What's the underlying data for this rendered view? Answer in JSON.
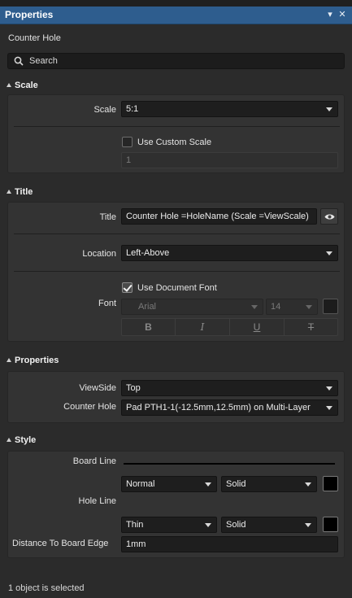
{
  "window": {
    "title": "Properties"
  },
  "object_type": "Counter Hole",
  "search": {
    "placeholder": "Search"
  },
  "sections": {
    "scale": {
      "header": "Scale",
      "scale_label": "Scale",
      "scale_value": "5:1",
      "use_custom_scale_label": "Use Custom Scale",
      "use_custom_scale_checked": false,
      "custom_scale_value": "1"
    },
    "title": {
      "header": "Title",
      "title_label": "Title",
      "title_value": "Counter Hole =HoleName (Scale =ViewScale)",
      "location_label": "Location",
      "location_value": "Left-Above",
      "font_label": "Font",
      "use_document_font_label": "Use Document Font",
      "use_document_font_checked": true,
      "font_family": "Arial",
      "font_size": "14",
      "format_buttons": [
        "B",
        "I",
        "U",
        "T"
      ]
    },
    "properties": {
      "header": "Properties",
      "viewside_label": "ViewSide",
      "viewside_value": "Top",
      "counter_hole_label": "Counter Hole",
      "counter_hole_value": "Pad PTH1-1(-12.5mm,12.5mm) on Multi-Layer"
    },
    "style": {
      "header": "Style",
      "board_line_label": "Board Line",
      "hole_line_label": "Hole Line",
      "hole_line_weight_1": "Normal",
      "hole_line_style_1": "Solid",
      "hole_line_weight_2": "Thin",
      "hole_line_style_2": "Solid",
      "distance_label": "Distance To Board Edge",
      "distance_value": "1mm"
    }
  },
  "status": "1 object is selected",
  "colors": {
    "titlebar": "#2e5d8e",
    "background": "#2b2b2b",
    "panel": "#333333",
    "input": "#1e1e1e",
    "line_color_1": "#000000",
    "line_color_2": "#000000"
  },
  "icons": {
    "titlebar_menu": "dropdown-arrow-icon",
    "titlebar_close": "close-icon",
    "search": "search-icon",
    "title_visibility": "eye-icon"
  }
}
